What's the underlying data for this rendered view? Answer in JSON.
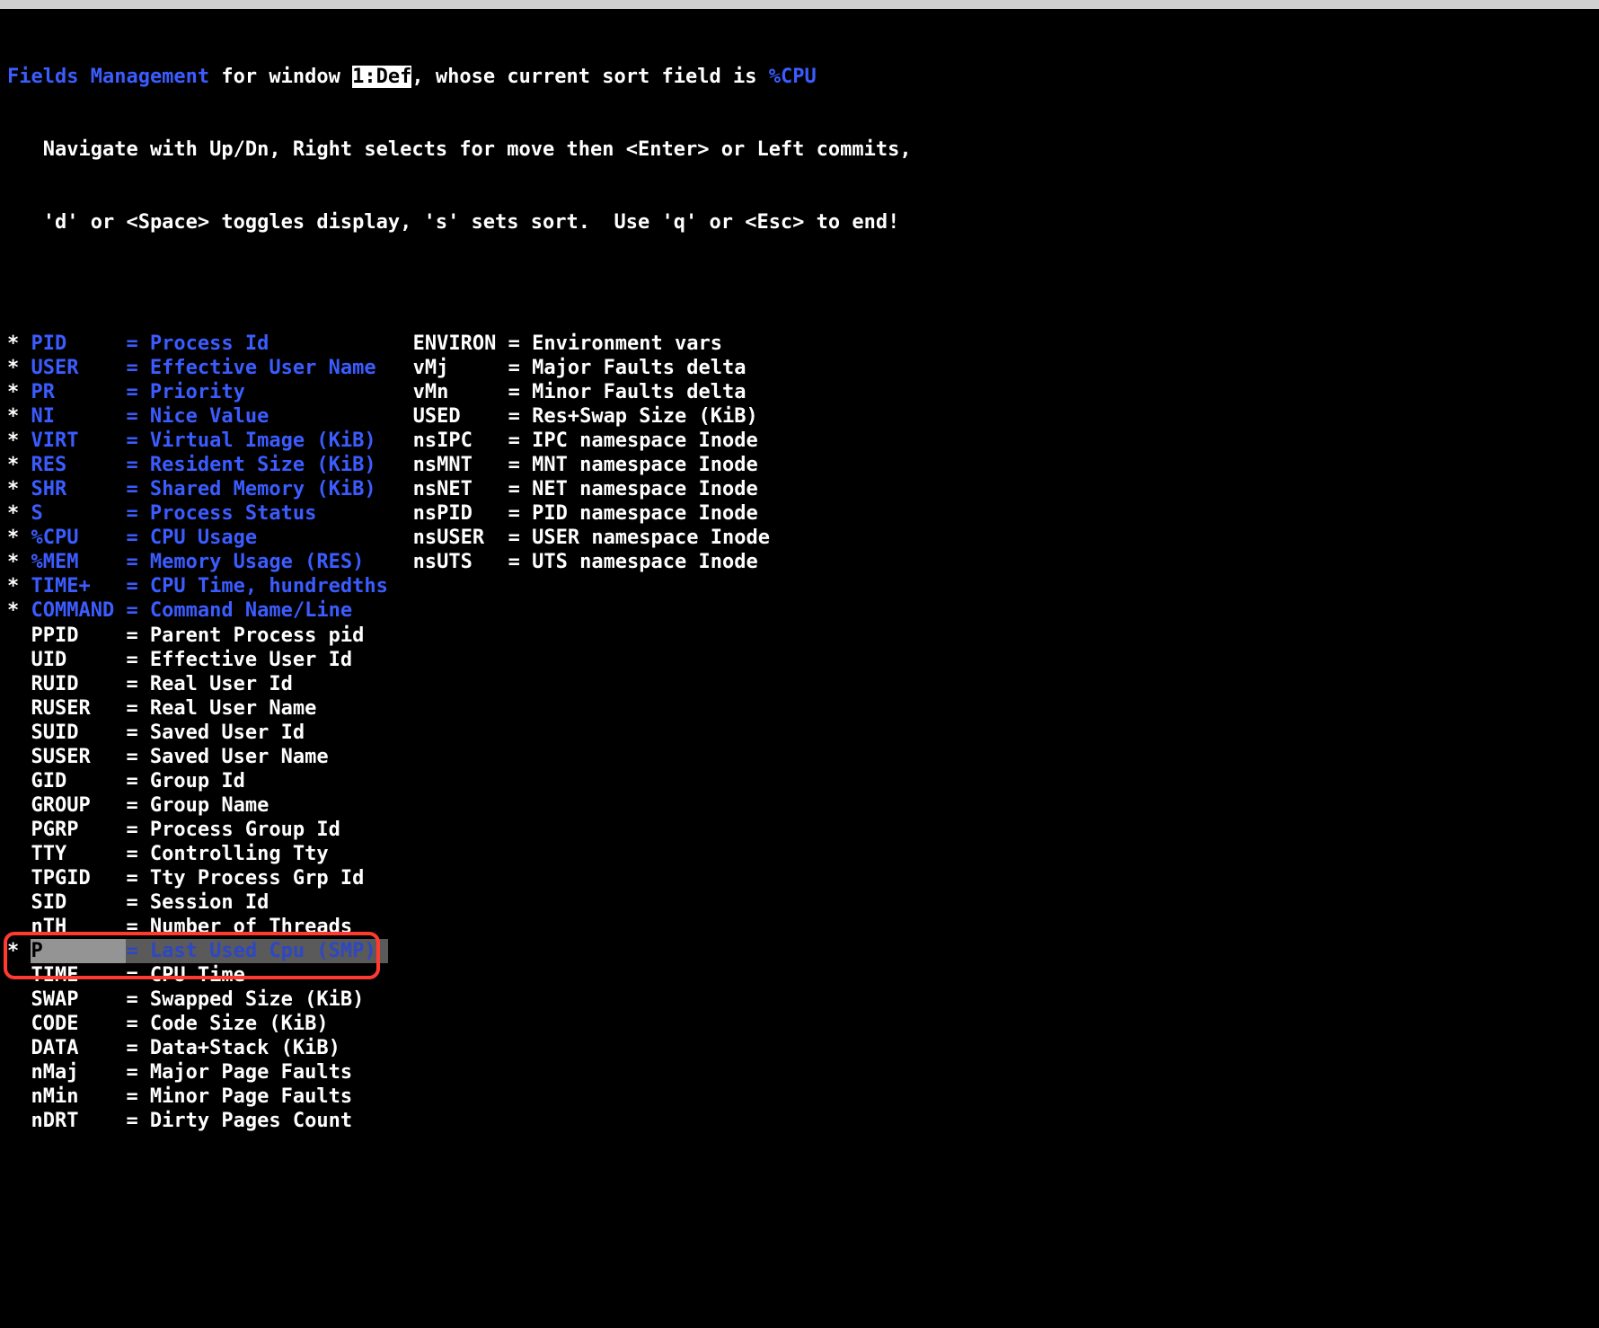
{
  "header": {
    "title_prefix": "Fields Management",
    "title_mid": " for window ",
    "window_label": "1:Def",
    "title_suffix": ", whose current sort field is ",
    "sort_field": "%CPU",
    "help_line1": "   Navigate with Up/Dn, Right selects for move then <Enter> or Left commits,",
    "help_line2": "   'd' or <Space> toggles display, 's' sets sort.  Use 'q' or <Esc> to end!"
  },
  "col1": [
    {
      "star": "* ",
      "key": "PID    ",
      "eq": "= ",
      "desc": "Process Id",
      "blue": true
    },
    {
      "star": "* ",
      "key": "USER   ",
      "eq": "= ",
      "desc": "Effective User Name",
      "blue": true
    },
    {
      "star": "* ",
      "key": "PR     ",
      "eq": "= ",
      "desc": "Priority",
      "blue": true
    },
    {
      "star": "* ",
      "key": "NI     ",
      "eq": "= ",
      "desc": "Nice Value",
      "blue": true
    },
    {
      "star": "* ",
      "key": "VIRT   ",
      "eq": "= ",
      "desc": "Virtual Image (KiB)",
      "blue": true
    },
    {
      "star": "* ",
      "key": "RES    ",
      "eq": "= ",
      "desc": "Resident Size (KiB)",
      "blue": true
    },
    {
      "star": "* ",
      "key": "SHR    ",
      "eq": "= ",
      "desc": "Shared Memory (KiB)",
      "blue": true
    },
    {
      "star": "* ",
      "key": "S      ",
      "eq": "= ",
      "desc": "Process Status",
      "blue": true
    },
    {
      "star": "* ",
      "key": "%CPU   ",
      "eq": "= ",
      "desc": "CPU Usage",
      "blue": true
    },
    {
      "star": "* ",
      "key": "%MEM   ",
      "eq": "= ",
      "desc": "Memory Usage (RES)",
      "blue": true
    },
    {
      "star": "* ",
      "key": "TIME+  ",
      "eq": "= ",
      "desc": "CPU Time, hundredths",
      "blue": true
    },
    {
      "star": "* ",
      "key": "COMMAND",
      "eq": "= ",
      "desc": "Command Name/Line",
      "blue": true
    },
    {
      "star": "  ",
      "key": "PPID   ",
      "eq": "= ",
      "desc": "Parent Process pid",
      "blue": false
    },
    {
      "star": "  ",
      "key": "UID    ",
      "eq": "= ",
      "desc": "Effective User Id",
      "blue": false
    },
    {
      "star": "  ",
      "key": "RUID   ",
      "eq": "= ",
      "desc": "Real User Id",
      "blue": false
    },
    {
      "star": "  ",
      "key": "RUSER  ",
      "eq": "= ",
      "desc": "Real User Name",
      "blue": false
    },
    {
      "star": "  ",
      "key": "SUID   ",
      "eq": "= ",
      "desc": "Saved User Id",
      "blue": false
    },
    {
      "star": "  ",
      "key": "SUSER  ",
      "eq": "= ",
      "desc": "Saved User Name",
      "blue": false
    },
    {
      "star": "  ",
      "key": "GID    ",
      "eq": "= ",
      "desc": "Group Id",
      "blue": false
    },
    {
      "star": "  ",
      "key": "GROUP  ",
      "eq": "= ",
      "desc": "Group Name",
      "blue": false
    },
    {
      "star": "  ",
      "key": "PGRP   ",
      "eq": "= ",
      "desc": "Process Group Id",
      "blue": false
    },
    {
      "star": "  ",
      "key": "TTY    ",
      "eq": "= ",
      "desc": "Controlling Tty",
      "blue": false
    },
    {
      "star": "  ",
      "key": "TPGID  ",
      "eq": "= ",
      "desc": "Tty Process Grp Id",
      "blue": false
    },
    {
      "star": "  ",
      "key": "SID    ",
      "eq": "= ",
      "desc": "Session Id",
      "blue": false
    },
    {
      "star": "  ",
      "key": "nTH    ",
      "eq": "= ",
      "desc": "Number of Threads",
      "blue": false
    },
    {
      "star": "* ",
      "key": "P      ",
      "eq": "= ",
      "desc": "Last Used Cpu (SMP)",
      "blue": true,
      "selected": true
    },
    {
      "star": "  ",
      "key": "TIME   ",
      "eq": "= ",
      "desc": "CPU Time",
      "blue": false
    },
    {
      "star": "  ",
      "key": "SWAP   ",
      "eq": "= ",
      "desc": "Swapped Size (KiB)",
      "blue": false
    },
    {
      "star": "  ",
      "key": "CODE   ",
      "eq": "= ",
      "desc": "Code Size (KiB)",
      "blue": false
    },
    {
      "star": "  ",
      "key": "DATA   ",
      "eq": "= ",
      "desc": "Data+Stack (KiB)",
      "blue": false
    },
    {
      "star": "  ",
      "key": "nMaj   ",
      "eq": "= ",
      "desc": "Major Page Faults",
      "blue": false
    },
    {
      "star": "  ",
      "key": "nMin   ",
      "eq": "= ",
      "desc": "Minor Page Faults",
      "blue": false
    },
    {
      "star": "  ",
      "key": "nDRT   ",
      "eq": "= ",
      "desc": "Dirty Pages Count",
      "blue": false
    }
  ],
  "col2": [
    {
      "star": "  ",
      "key": "ENVIRON",
      "eq": "= ",
      "desc": "Environment vars",
      "blue": false
    },
    {
      "star": "  ",
      "key": "vMj    ",
      "eq": "= ",
      "desc": "Major Faults delta",
      "blue": false
    },
    {
      "star": "  ",
      "key": "vMn    ",
      "eq": "= ",
      "desc": "Minor Faults delta",
      "blue": false
    },
    {
      "star": "  ",
      "key": "USED   ",
      "eq": "= ",
      "desc": "Res+Swap Size (KiB)",
      "blue": false
    },
    {
      "star": "  ",
      "key": "nsIPC  ",
      "eq": "= ",
      "desc": "IPC namespace Inode",
      "blue": false
    },
    {
      "star": "  ",
      "key": "nsMNT  ",
      "eq": "= ",
      "desc": "MNT namespace Inode",
      "blue": false
    },
    {
      "star": "  ",
      "key": "nsNET  ",
      "eq": "= ",
      "desc": "NET namespace Inode",
      "blue": false
    },
    {
      "star": "  ",
      "key": "nsPID  ",
      "eq": "= ",
      "desc": "PID namespace Inode",
      "blue": false
    },
    {
      "star": "  ",
      "key": "nsUSER ",
      "eq": "= ",
      "desc": "USER namespace Inode",
      "blue": false
    },
    {
      "star": "  ",
      "key": "nsUTS  ",
      "eq": "= ",
      "desc": "UTS namespace Inode",
      "blue": false
    }
  ]
}
